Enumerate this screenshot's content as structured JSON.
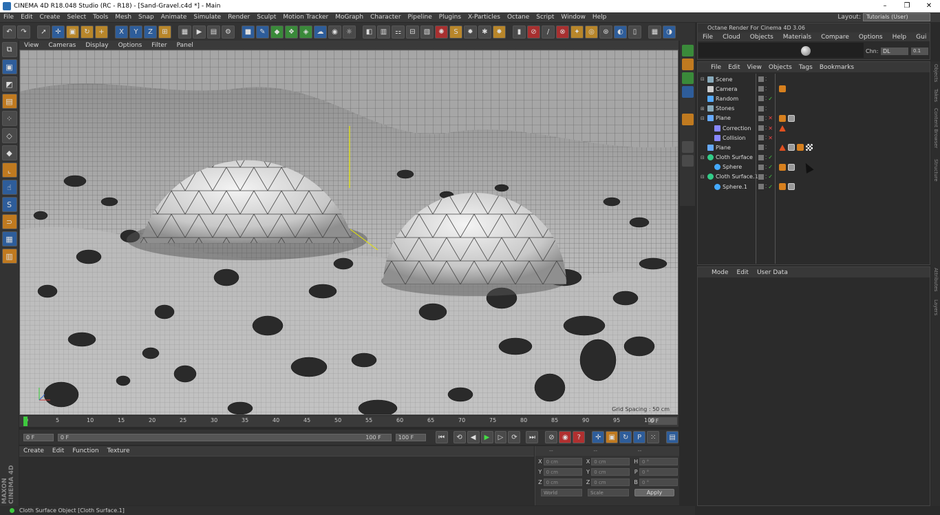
{
  "window": {
    "title": "CINEMA 4D R18.048 Studio (RC - R18) - [Sand-Gravel.c4d *] - Main",
    "controls": [
      "–",
      "❐",
      "✕"
    ]
  },
  "menubar": [
    "File",
    "Edit",
    "Create",
    "Select",
    "Tools",
    "Mesh",
    "Snap",
    "Animate",
    "Simulate",
    "Render",
    "Sculpt",
    "Motion Tracker",
    "MoGraph",
    "Character",
    "Pipeline",
    "Plugins",
    "X-Particles",
    "Octane",
    "Script",
    "Window",
    "Help"
  ],
  "layout": {
    "label": "Layout:",
    "value": "Tutorials (User)"
  },
  "viewport": {
    "menu": [
      "View",
      "Cameras",
      "Display",
      "Options",
      "Filter",
      "Panel"
    ],
    "grid_spacing": "Grid Spacing : 50 cm"
  },
  "timeline": {
    "ticks": [
      "0",
      "5",
      "10",
      "15",
      "20",
      "25",
      "30",
      "35",
      "40",
      "45",
      "50",
      "55",
      "60",
      "65",
      "70",
      "75",
      "80",
      "85",
      "90",
      "95",
      "100"
    ],
    "current_frame": "0 F"
  },
  "playbar": {
    "start": "0 F",
    "range_start": "0 F",
    "range_end": "100 F",
    "end": "100 F"
  },
  "material_manager": {
    "menu": [
      "Create",
      "Edit",
      "Function",
      "Texture"
    ]
  },
  "coordinates": {
    "header_dashes": [
      "--",
      "--",
      "--"
    ],
    "rows": [
      {
        "pos_label": "X",
        "pos": "0 cm",
        "size_label": "X",
        "size": "0 cm",
        "rot_label": "H",
        "rot": "0 °"
      },
      {
        "pos_label": "Y",
        "pos": "0 cm",
        "size_label": "Y",
        "size": "0 cm",
        "rot_label": "P",
        "rot": "0 °"
      },
      {
        "pos_label": "Z",
        "pos": "0 cm",
        "size_label": "Z",
        "size": "0 cm",
        "rot_label": "B",
        "rot": "0 °"
      }
    ],
    "space": "World",
    "mode": "Scale",
    "apply": "Apply"
  },
  "status": "Cloth Surface Object [Cloth Surface.1]",
  "octane": {
    "title": "Octane Render For Cinema 4D 3.06",
    "menu": [
      "File",
      "Cloud",
      "Objects",
      "Materials",
      "Compare",
      "Options",
      "Help",
      "Gui"
    ],
    "chn_label": "Chn:",
    "chn_value": "DL",
    "chn_num": "0.1"
  },
  "object_manager": {
    "menu": [
      "File",
      "Edit",
      "View",
      "Objects",
      "Tags",
      "Bookmarks"
    ],
    "objects": [
      {
        "name": "Scene",
        "indent": 0,
        "expander": "⊟",
        "icon": "null",
        "check": "",
        "tags": []
      },
      {
        "name": "Camera",
        "indent": 0,
        "expander": "",
        "icon": "camera",
        "check": "",
        "tags": [
          "orange"
        ]
      },
      {
        "name": "Random",
        "indent": 0,
        "expander": "",
        "icon": "effector",
        "check": "✓",
        "tags": []
      },
      {
        "name": "Stones",
        "indent": 0,
        "expander": "⊞",
        "icon": "null",
        "check": "",
        "tags": []
      },
      {
        "name": "Plane",
        "indent": 0,
        "expander": "⊟",
        "icon": "plane",
        "check": "✕",
        "tags": [
          "orange",
          "gray"
        ]
      },
      {
        "name": "Correction",
        "indent": 1,
        "expander": "",
        "icon": "deformer",
        "check": "✕",
        "tags": [
          "red"
        ]
      },
      {
        "name": "Collision",
        "indent": 1,
        "expander": "",
        "icon": "deformer",
        "check": "✕",
        "tags": []
      },
      {
        "name": "Plane",
        "indent": 0,
        "expander": "",
        "icon": "plane",
        "check": "",
        "tags": [
          "red",
          "gray",
          "orange",
          "check"
        ]
      },
      {
        "name": "Cloth Surface",
        "indent": 0,
        "expander": "⊟",
        "icon": "cloth",
        "check": "✓",
        "tags": []
      },
      {
        "name": "Sphere",
        "indent": 1,
        "expander": "",
        "icon": "sphere",
        "check": "✓",
        "tags": [
          "orange",
          "gray"
        ]
      },
      {
        "name": "Cloth Surface.1",
        "indent": 0,
        "expander": "⊟",
        "icon": "cloth",
        "check": "✓",
        "tags": []
      },
      {
        "name": "Sphere.1",
        "indent": 1,
        "expander": "",
        "icon": "sphere",
        "check": "✓",
        "tags": [
          "orange",
          "gray"
        ]
      }
    ]
  },
  "attribute_manager": {
    "menu": [
      "Mode",
      "Edit",
      "User Data"
    ]
  },
  "side_tabs": [
    "Objects",
    "Takes",
    "Content Browser",
    "Structure",
    "Attributes",
    "Layers"
  ],
  "colors": {
    "accent_blue": "#2e5d9a",
    "accent_orange": "#c07a20",
    "status_green": "#3ec93e"
  }
}
